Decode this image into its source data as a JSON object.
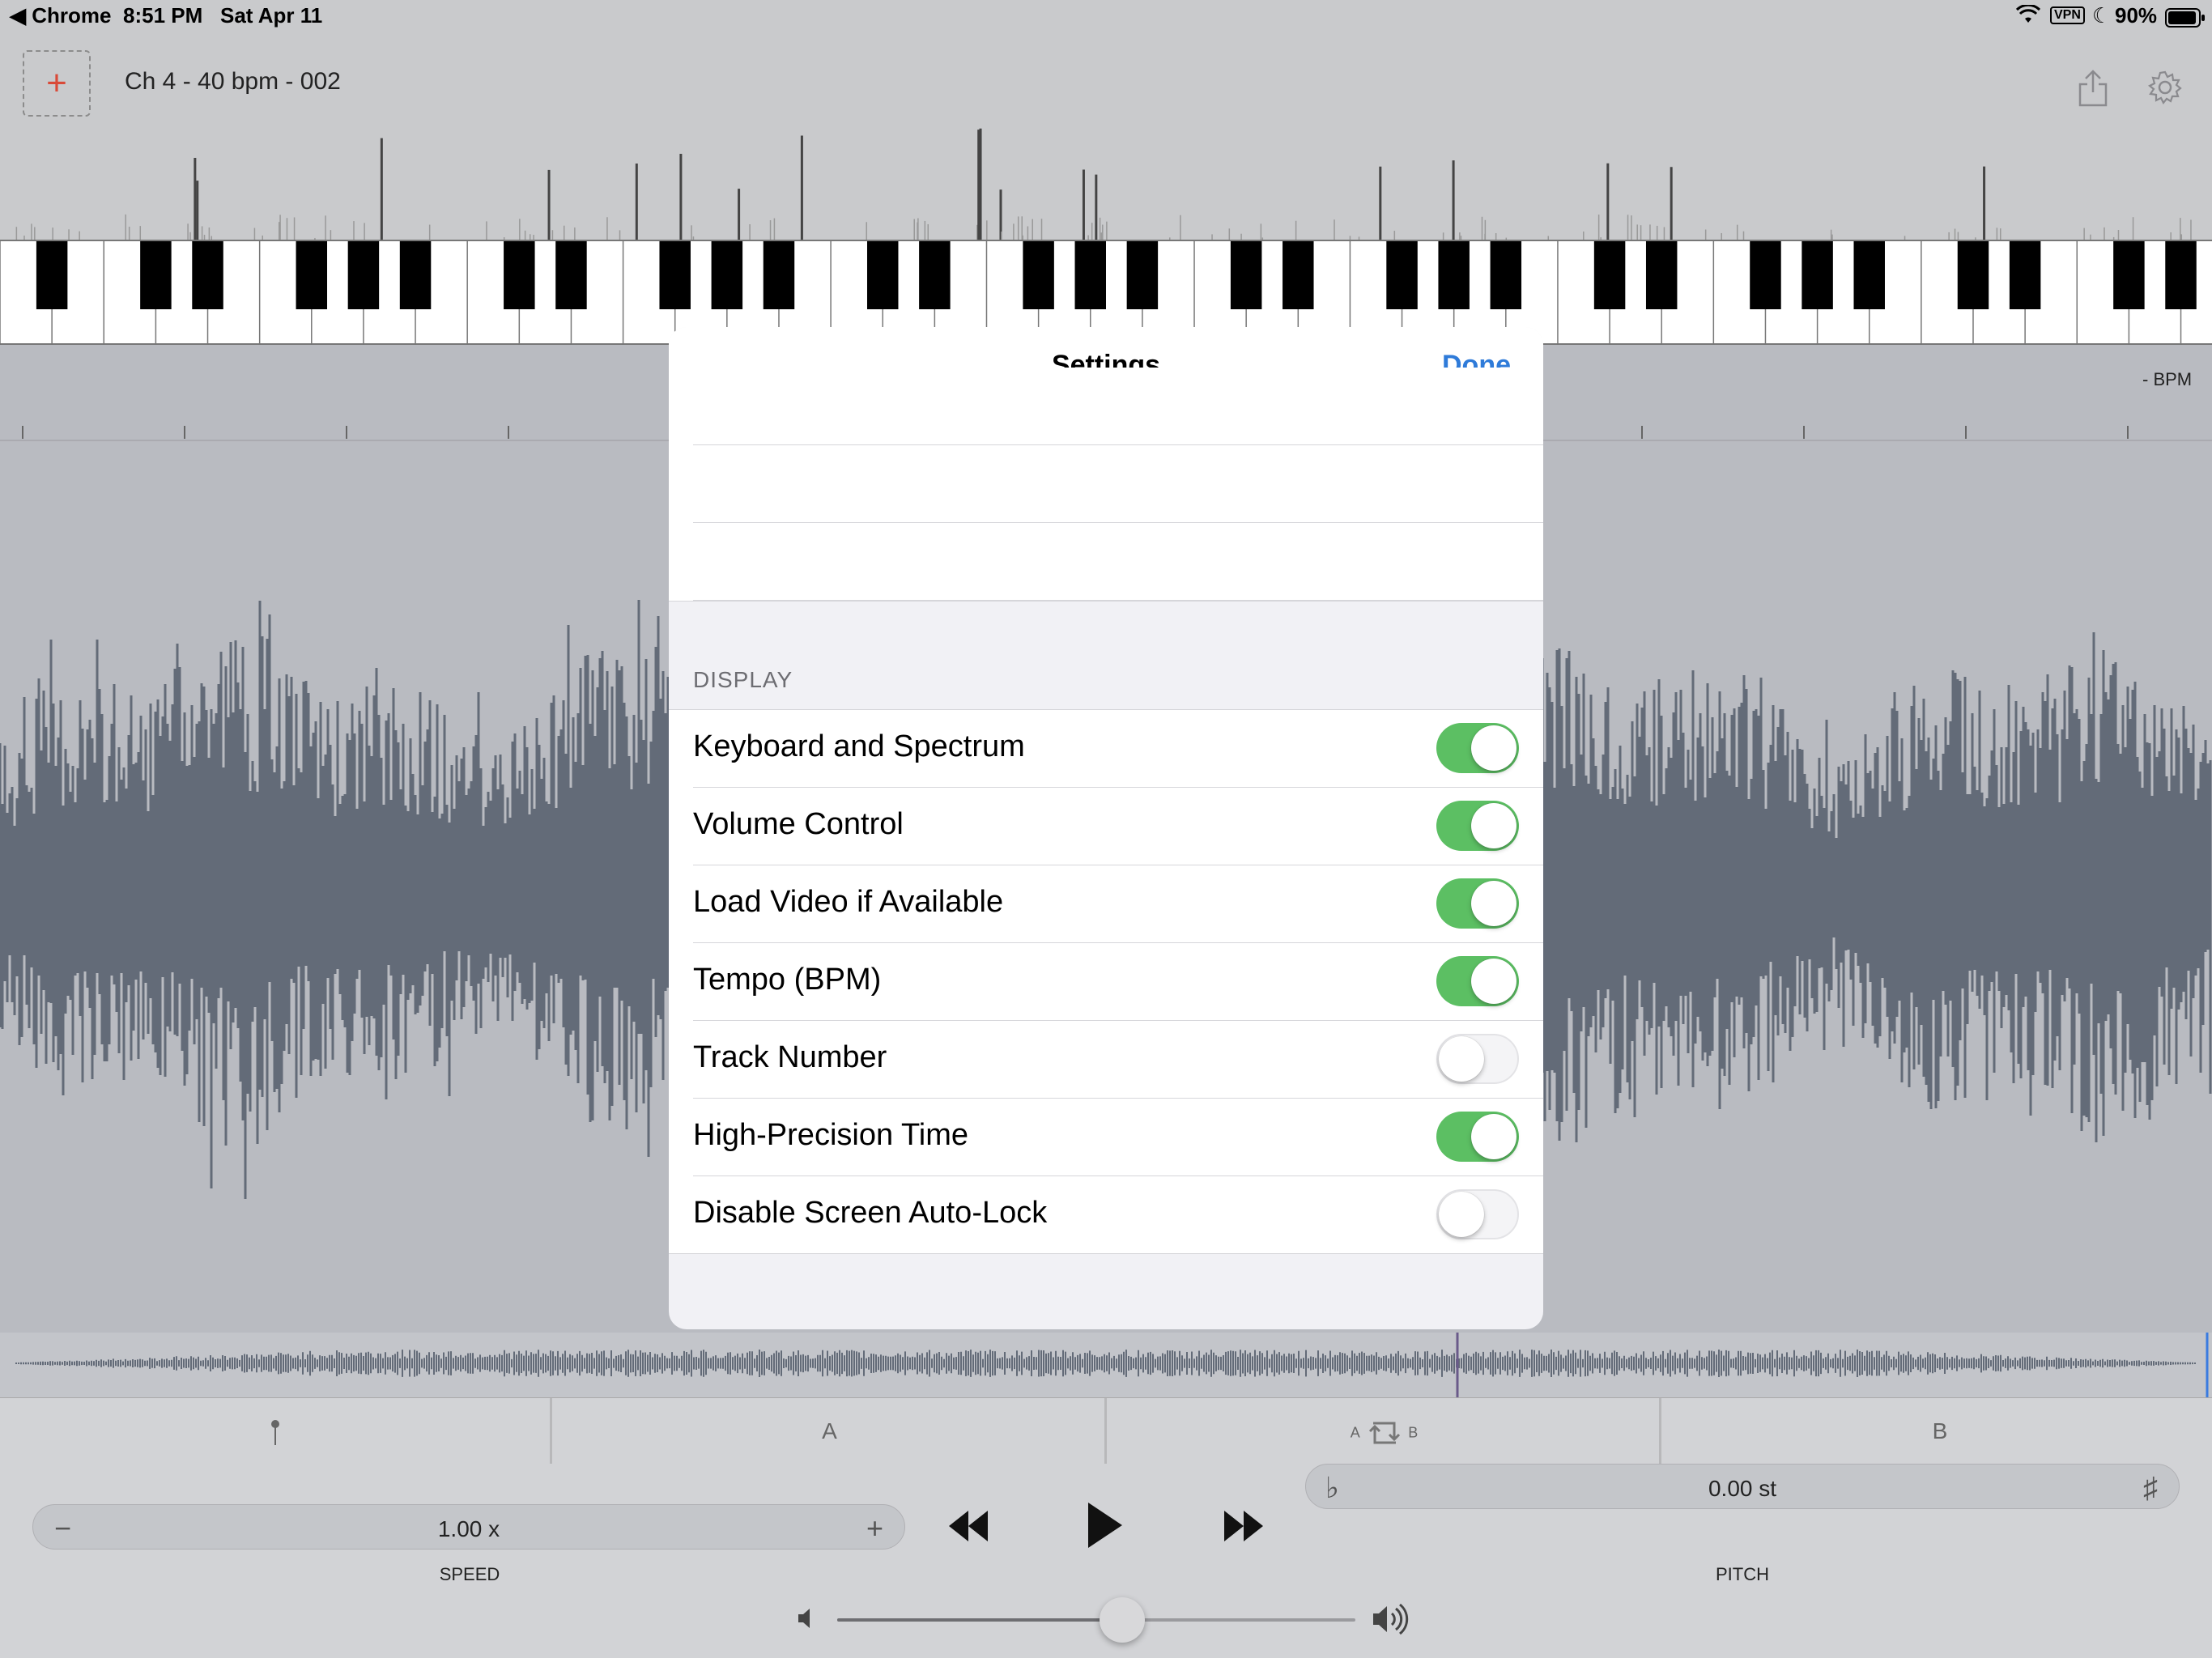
{
  "status_bar": {
    "back_app": "◀ Chrome",
    "time": "8:51 PM",
    "date": "Sat Apr 11",
    "vpn": "VPN",
    "battery": "90%"
  },
  "toolbar": {
    "add_label": "+",
    "document_title": "Ch 4 - 40 bpm - 002"
  },
  "timeline": {
    "bpm_label": "- BPM"
  },
  "ab_bar": {
    "marker_label": "",
    "a_label": "A",
    "loop_a": "A",
    "loop_b": "B",
    "b_label": "B"
  },
  "transport": {
    "speed_value": "1.00 x",
    "speed_minus": "−",
    "speed_plus": "+",
    "speed_caption": "SPEED",
    "pitch_value": "0.00 st",
    "pitch_flat": "♭",
    "pitch_sharp": "♯",
    "pitch_caption": "PITCH",
    "volume_level": 0.55
  },
  "settings": {
    "title": "Settings",
    "done_label": "Done",
    "section_display": "DISPLAY",
    "rows": [
      {
        "label": "Keyboard and Spectrum",
        "on": true
      },
      {
        "label": "Volume Control",
        "on": true
      },
      {
        "label": "Load Video if Available",
        "on": true
      },
      {
        "label": "Tempo (BPM)",
        "on": true
      },
      {
        "label": "Track Number",
        "on": false
      },
      {
        "label": "High-Precision Time",
        "on": true
      },
      {
        "label": "Disable Screen Auto-Lock",
        "on": false
      }
    ]
  },
  "colors": {
    "accent": "#2f7bd9",
    "switch_on": "#5cbf63",
    "waveform": "#636b78"
  }
}
